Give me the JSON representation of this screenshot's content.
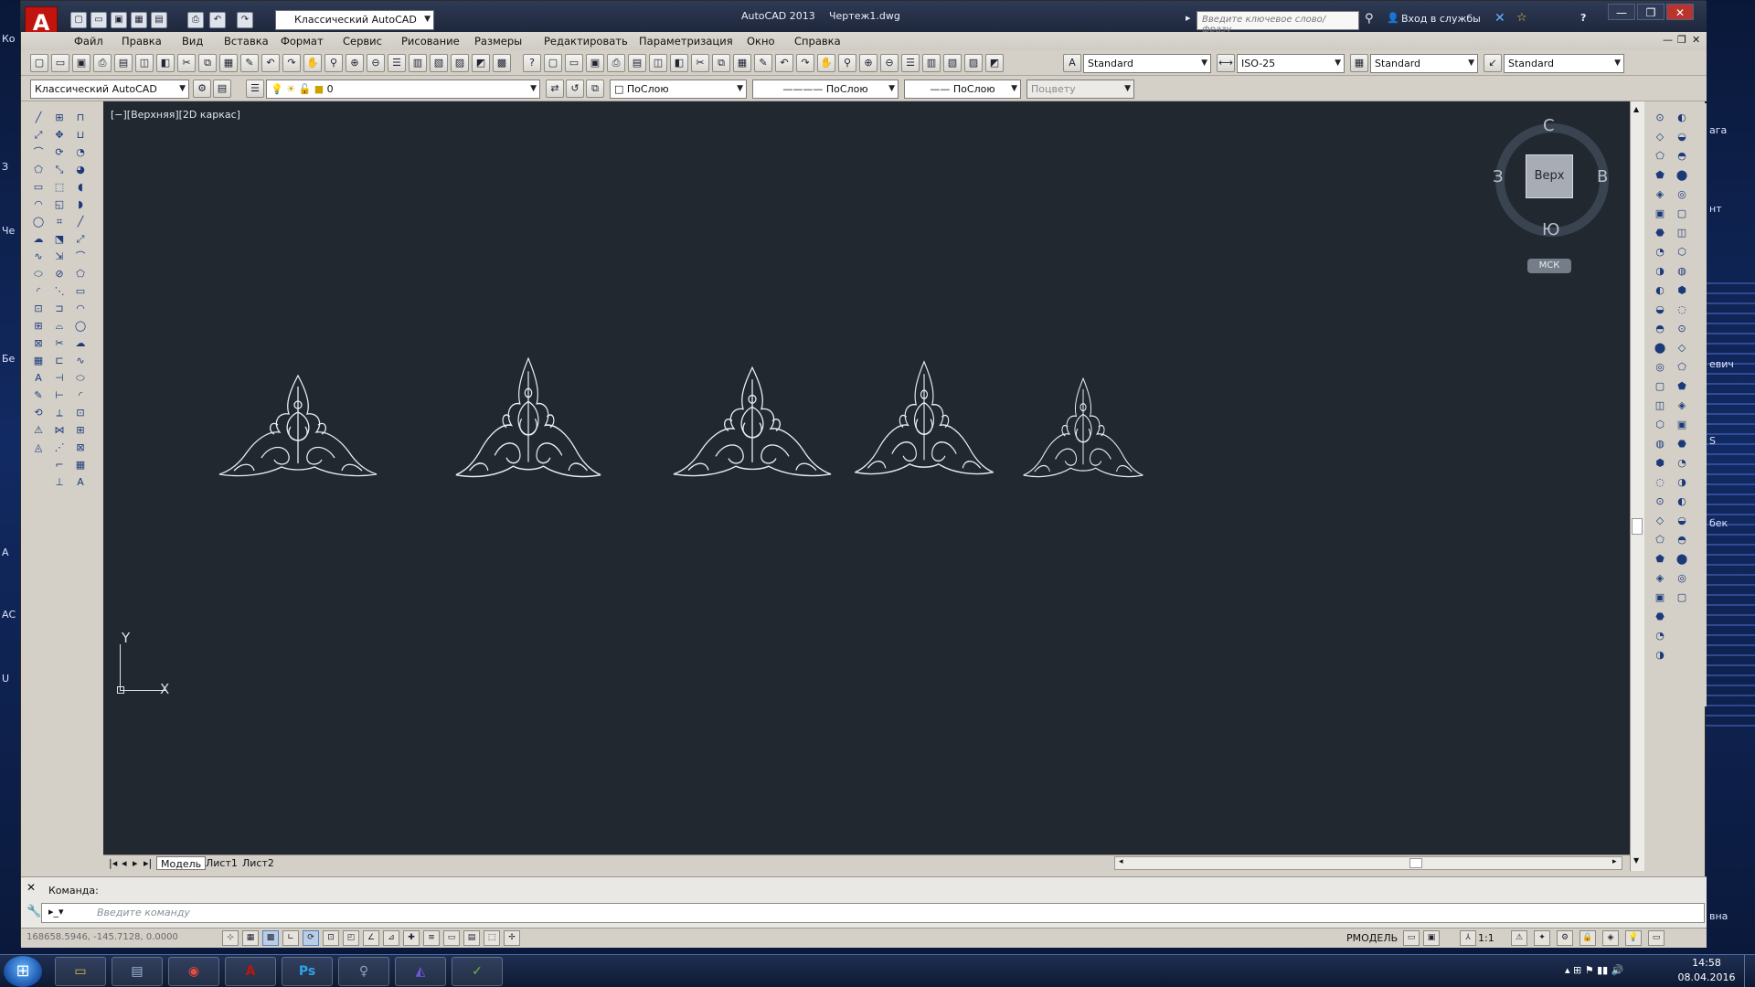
{
  "desktop": {
    "left_labels": [
      "Ко",
      "З",
      "Че",
      "Бе",
      "А",
      "АС",
      "U"
    ],
    "right_labels": [
      "ага",
      "нт",
      "евич",
      "S",
      "бек",
      "вна"
    ]
  },
  "titlebar": {
    "workspace": "Классический AutoCAD",
    "app_title": "AutoCAD 2013",
    "doc_title": "Чертеж1.dwg",
    "search_placeholder": "Введите ключевое слово/фразу",
    "signin": "Вход в службы",
    "help": "?",
    "controls": [
      "—",
      "❐",
      "✕"
    ]
  },
  "menu": [
    "Файл",
    "Правка",
    "Вид",
    "Вставка",
    "Формат",
    "Сервис",
    "Рисование",
    "Размеры",
    "Редактировать",
    "Параметризация",
    "Окно",
    "Справка"
  ],
  "styles_toolbar": {
    "text_style": "Standard",
    "dim_style": "ISO-25",
    "table_style": "Standard",
    "multileader_style": "Standard"
  },
  "layers_toolbar": {
    "workspace": "Классический AutoCAD",
    "layer": "0",
    "color": "ПоСлою",
    "linetype": "ПоСлою",
    "lineweight": "ПоСлою",
    "plotstyle": "Поцвету"
  },
  "viewport": {
    "label": "[−][Верхняя][2D каркас]",
    "viewcube_face": "Верх",
    "compass": {
      "n": "С",
      "s": "Ю",
      "w": "З",
      "e": "В"
    },
    "wcs": "МСК",
    "ucs_x": "X",
    "ucs_y": "Y"
  },
  "layout_tabs": [
    "Модель",
    "Лист1",
    "Лист2"
  ],
  "command": {
    "label": "Команда:",
    "placeholder": "Введите команду"
  },
  "status": {
    "coords": "168658.5946, -145.7128, 0.0000",
    "model": "РМОДЕЛЬ",
    "scale": "1:1"
  },
  "taskbar": {
    "apps": [
      {
        "name": "explorer",
        "glyph": "▭",
        "color": "#e6b84a"
      },
      {
        "name": "calculator",
        "glyph": "▤",
        "color": "#9bb8d8"
      },
      {
        "name": "chrome",
        "glyph": "◉",
        "color": "#e94b3c"
      },
      {
        "name": "autocad",
        "glyph": "A",
        "color": "#c1140e"
      },
      {
        "name": "photoshop",
        "glyph": "Ps",
        "color": "#2aa4e8"
      },
      {
        "name": "app6",
        "glyph": "♀",
        "color": "#8aa0b8"
      },
      {
        "name": "app7",
        "glyph": "◭",
        "color": "#6a5ad8"
      },
      {
        "name": "coreldraw",
        "glyph": "✓",
        "color": "#6cbf3c"
      }
    ],
    "time": "14:58",
    "date": "08.04.2016"
  }
}
